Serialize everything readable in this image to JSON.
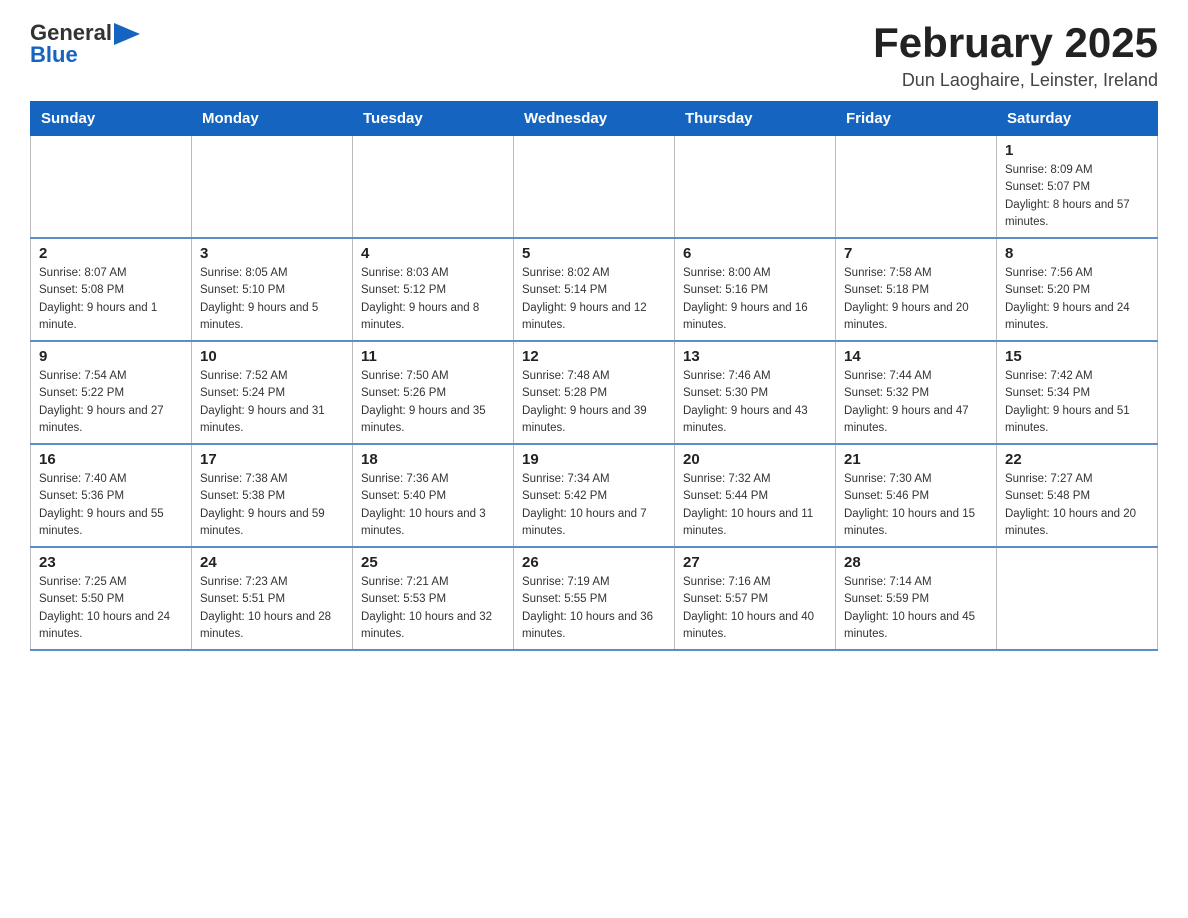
{
  "header": {
    "logo": {
      "general": "General",
      "blue": "Blue"
    },
    "title": "February 2025",
    "location": "Dun Laoghaire, Leinster, Ireland"
  },
  "calendar": {
    "days": [
      "Sunday",
      "Monday",
      "Tuesday",
      "Wednesday",
      "Thursday",
      "Friday",
      "Saturday"
    ],
    "weeks": [
      [
        {
          "day": "",
          "sunrise": "",
          "sunset": "",
          "daylight": ""
        },
        {
          "day": "",
          "sunrise": "",
          "sunset": "",
          "daylight": ""
        },
        {
          "day": "",
          "sunrise": "",
          "sunset": "",
          "daylight": ""
        },
        {
          "day": "",
          "sunrise": "",
          "sunset": "",
          "daylight": ""
        },
        {
          "day": "",
          "sunrise": "",
          "sunset": "",
          "daylight": ""
        },
        {
          "day": "",
          "sunrise": "",
          "sunset": "",
          "daylight": ""
        },
        {
          "day": "1",
          "sunrise": "Sunrise: 8:09 AM",
          "sunset": "Sunset: 5:07 PM",
          "daylight": "Daylight: 8 hours and 57 minutes."
        }
      ],
      [
        {
          "day": "2",
          "sunrise": "Sunrise: 8:07 AM",
          "sunset": "Sunset: 5:08 PM",
          "daylight": "Daylight: 9 hours and 1 minute."
        },
        {
          "day": "3",
          "sunrise": "Sunrise: 8:05 AM",
          "sunset": "Sunset: 5:10 PM",
          "daylight": "Daylight: 9 hours and 5 minutes."
        },
        {
          "day": "4",
          "sunrise": "Sunrise: 8:03 AM",
          "sunset": "Sunset: 5:12 PM",
          "daylight": "Daylight: 9 hours and 8 minutes."
        },
        {
          "day": "5",
          "sunrise": "Sunrise: 8:02 AM",
          "sunset": "Sunset: 5:14 PM",
          "daylight": "Daylight: 9 hours and 12 minutes."
        },
        {
          "day": "6",
          "sunrise": "Sunrise: 8:00 AM",
          "sunset": "Sunset: 5:16 PM",
          "daylight": "Daylight: 9 hours and 16 minutes."
        },
        {
          "day": "7",
          "sunrise": "Sunrise: 7:58 AM",
          "sunset": "Sunset: 5:18 PM",
          "daylight": "Daylight: 9 hours and 20 minutes."
        },
        {
          "day": "8",
          "sunrise": "Sunrise: 7:56 AM",
          "sunset": "Sunset: 5:20 PM",
          "daylight": "Daylight: 9 hours and 24 minutes."
        }
      ],
      [
        {
          "day": "9",
          "sunrise": "Sunrise: 7:54 AM",
          "sunset": "Sunset: 5:22 PM",
          "daylight": "Daylight: 9 hours and 27 minutes."
        },
        {
          "day": "10",
          "sunrise": "Sunrise: 7:52 AM",
          "sunset": "Sunset: 5:24 PM",
          "daylight": "Daylight: 9 hours and 31 minutes."
        },
        {
          "day": "11",
          "sunrise": "Sunrise: 7:50 AM",
          "sunset": "Sunset: 5:26 PM",
          "daylight": "Daylight: 9 hours and 35 minutes."
        },
        {
          "day": "12",
          "sunrise": "Sunrise: 7:48 AM",
          "sunset": "Sunset: 5:28 PM",
          "daylight": "Daylight: 9 hours and 39 minutes."
        },
        {
          "day": "13",
          "sunrise": "Sunrise: 7:46 AM",
          "sunset": "Sunset: 5:30 PM",
          "daylight": "Daylight: 9 hours and 43 minutes."
        },
        {
          "day": "14",
          "sunrise": "Sunrise: 7:44 AM",
          "sunset": "Sunset: 5:32 PM",
          "daylight": "Daylight: 9 hours and 47 minutes."
        },
        {
          "day": "15",
          "sunrise": "Sunrise: 7:42 AM",
          "sunset": "Sunset: 5:34 PM",
          "daylight": "Daylight: 9 hours and 51 minutes."
        }
      ],
      [
        {
          "day": "16",
          "sunrise": "Sunrise: 7:40 AM",
          "sunset": "Sunset: 5:36 PM",
          "daylight": "Daylight: 9 hours and 55 minutes."
        },
        {
          "day": "17",
          "sunrise": "Sunrise: 7:38 AM",
          "sunset": "Sunset: 5:38 PM",
          "daylight": "Daylight: 9 hours and 59 minutes."
        },
        {
          "day": "18",
          "sunrise": "Sunrise: 7:36 AM",
          "sunset": "Sunset: 5:40 PM",
          "daylight": "Daylight: 10 hours and 3 minutes."
        },
        {
          "day": "19",
          "sunrise": "Sunrise: 7:34 AM",
          "sunset": "Sunset: 5:42 PM",
          "daylight": "Daylight: 10 hours and 7 minutes."
        },
        {
          "day": "20",
          "sunrise": "Sunrise: 7:32 AM",
          "sunset": "Sunset: 5:44 PM",
          "daylight": "Daylight: 10 hours and 11 minutes."
        },
        {
          "day": "21",
          "sunrise": "Sunrise: 7:30 AM",
          "sunset": "Sunset: 5:46 PM",
          "daylight": "Daylight: 10 hours and 15 minutes."
        },
        {
          "day": "22",
          "sunrise": "Sunrise: 7:27 AM",
          "sunset": "Sunset: 5:48 PM",
          "daylight": "Daylight: 10 hours and 20 minutes."
        }
      ],
      [
        {
          "day": "23",
          "sunrise": "Sunrise: 7:25 AM",
          "sunset": "Sunset: 5:50 PM",
          "daylight": "Daylight: 10 hours and 24 minutes."
        },
        {
          "day": "24",
          "sunrise": "Sunrise: 7:23 AM",
          "sunset": "Sunset: 5:51 PM",
          "daylight": "Daylight: 10 hours and 28 minutes."
        },
        {
          "day": "25",
          "sunrise": "Sunrise: 7:21 AM",
          "sunset": "Sunset: 5:53 PM",
          "daylight": "Daylight: 10 hours and 32 minutes."
        },
        {
          "day": "26",
          "sunrise": "Sunrise: 7:19 AM",
          "sunset": "Sunset: 5:55 PM",
          "daylight": "Daylight: 10 hours and 36 minutes."
        },
        {
          "day": "27",
          "sunrise": "Sunrise: 7:16 AM",
          "sunset": "Sunset: 5:57 PM",
          "daylight": "Daylight: 10 hours and 40 minutes."
        },
        {
          "day": "28",
          "sunrise": "Sunrise: 7:14 AM",
          "sunset": "Sunset: 5:59 PM",
          "daylight": "Daylight: 10 hours and 45 minutes."
        },
        {
          "day": "",
          "sunrise": "",
          "sunset": "",
          "daylight": ""
        }
      ]
    ]
  }
}
